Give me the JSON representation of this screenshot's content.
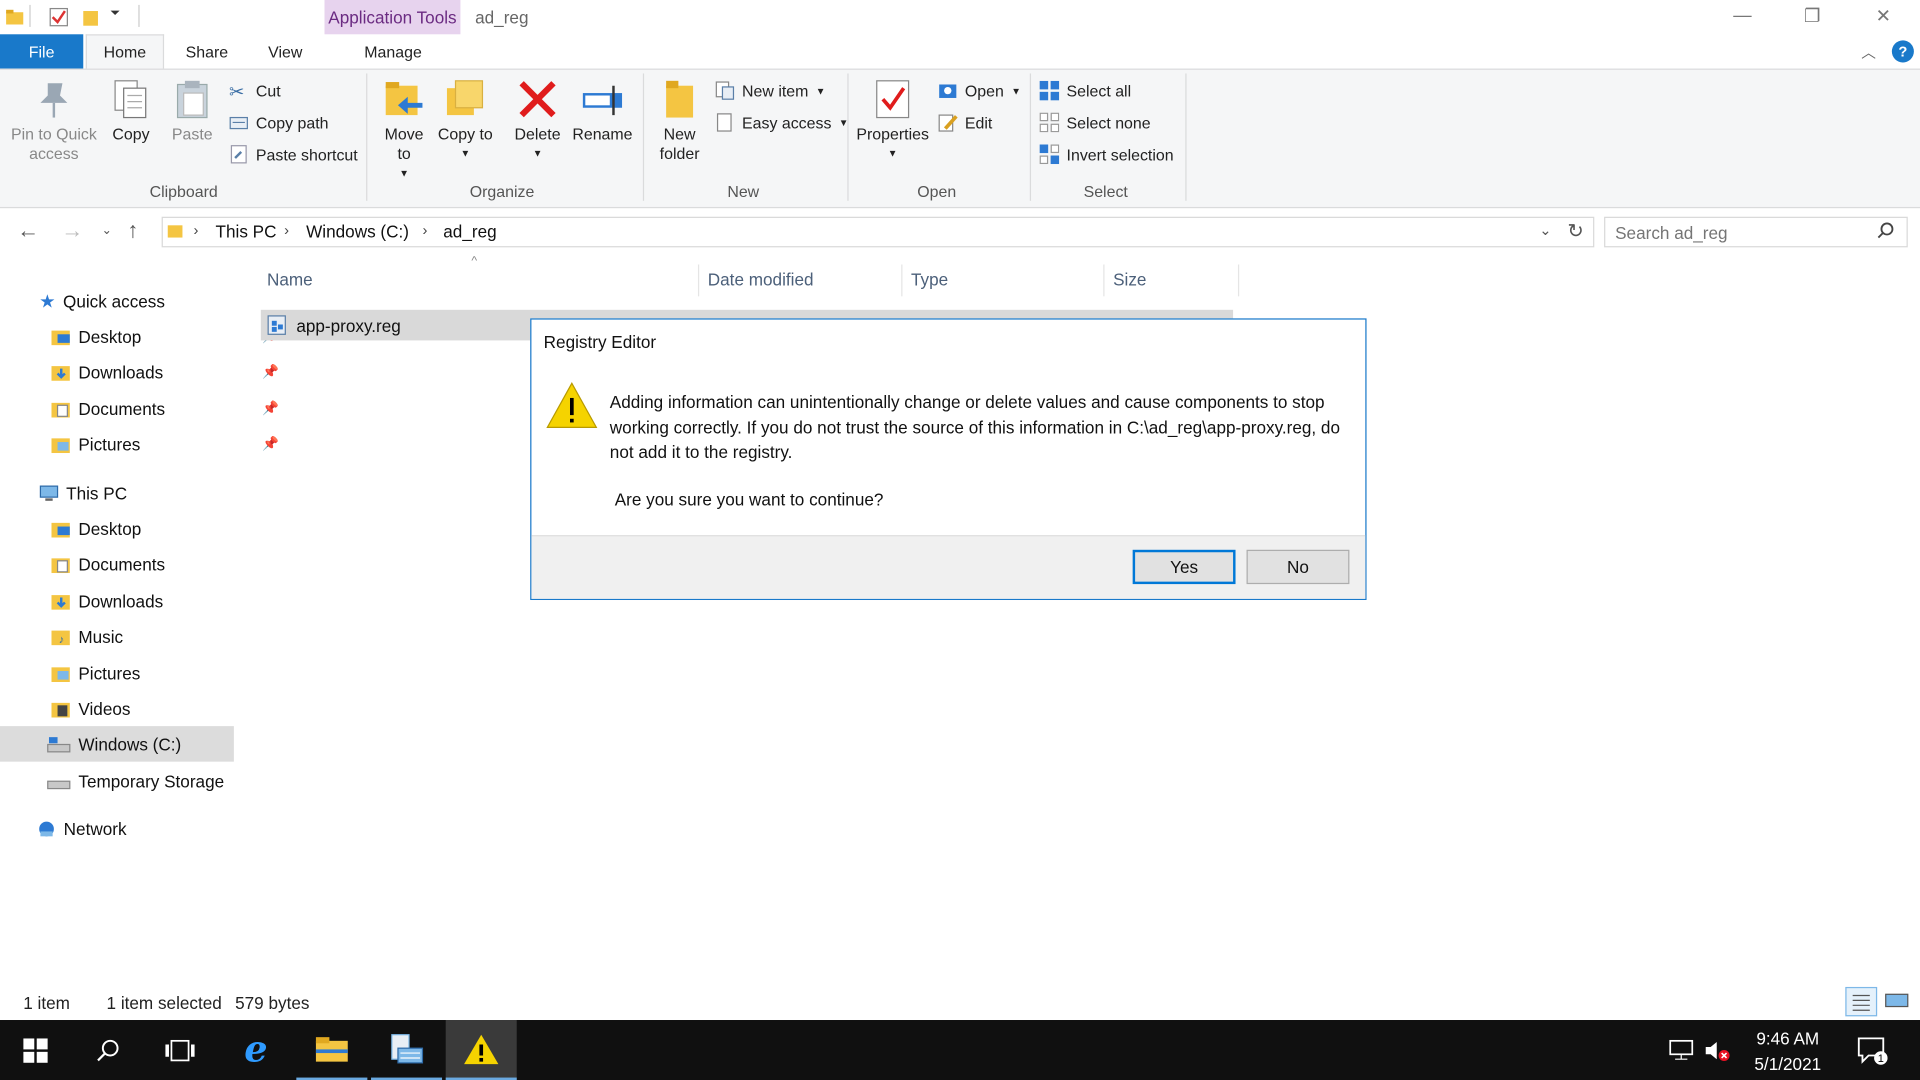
{
  "window": {
    "contextual_tab": "Application Tools",
    "title": "ad_reg",
    "controls": {
      "minimize": "—",
      "restore": "❐",
      "close": "✕"
    }
  },
  "tabs": [
    "File",
    "Home",
    "Share",
    "View",
    "Manage"
  ],
  "ribbon": {
    "clipboard": {
      "label": "Clipboard",
      "pin": "Pin to Quick access",
      "copy": "Copy",
      "paste": "Paste",
      "cut": "Cut",
      "copy_path": "Copy path",
      "paste_shortcut": "Paste shortcut"
    },
    "organize": {
      "label": "Organize",
      "move_to": "Move to",
      "copy_to": "Copy to",
      "delete": "Delete",
      "rename": "Rename"
    },
    "new": {
      "label": "New",
      "new_folder": "New folder",
      "new_item": "New item",
      "easy_access": "Easy access"
    },
    "open": {
      "label": "Open",
      "properties": "Properties",
      "open": "Open",
      "edit": "Edit"
    },
    "select": {
      "label": "Select",
      "select_all": "Select all",
      "select_none": "Select none",
      "invert": "Invert selection"
    }
  },
  "address": {
    "crumbs": [
      "This PC",
      "Windows (C:)",
      "ad_reg"
    ],
    "search_placeholder": "Search ad_reg"
  },
  "nav": {
    "quick_access": "Quick access",
    "qa_items": [
      "Desktop",
      "Downloads",
      "Documents",
      "Pictures"
    ],
    "this_pc": "This PC",
    "pc_items": [
      "Desktop",
      "Documents",
      "Downloads",
      "Music",
      "Pictures",
      "Videos",
      "Windows (C:)",
      "Temporary Storage"
    ],
    "network": "Network"
  },
  "columns": [
    "Name",
    "Date modified",
    "Type",
    "Size"
  ],
  "files": [
    {
      "name": "app-proxy.reg"
    }
  ],
  "dialog": {
    "title": "Registry Editor",
    "message": "Adding information can unintentionally change or delete values and cause components to stop working correctly. If you do not trust the source of this information in C:\\ad_reg\\app-proxy.reg, do not add it to the registry.",
    "question": "Are you sure you want to continue?",
    "yes": "Yes",
    "no": "No"
  },
  "status": {
    "count": "1 item",
    "selected": "1 item selected",
    "size": "579 bytes"
  },
  "clock": {
    "time": "9:46 AM",
    "date": "5/1/2021"
  },
  "colors": {
    "accent": "#1979ca",
    "contextual": "#e7d3ee",
    "warning": "#f5d300"
  }
}
